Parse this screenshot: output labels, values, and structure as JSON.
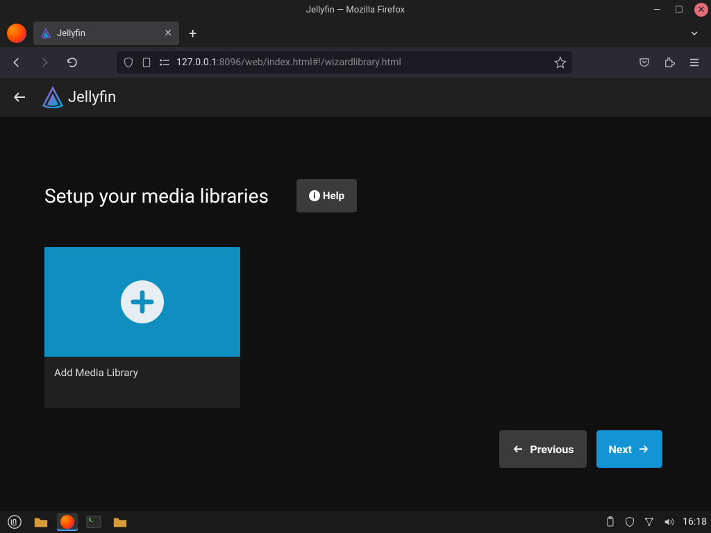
{
  "window": {
    "title": "Jellyfin — Mozilla Firefox"
  },
  "tab": {
    "title": "Jellyfin"
  },
  "url": {
    "host": "127.0.0.1",
    "port_path": ":8096/web/index.html#!/wizardlibrary.html"
  },
  "app": {
    "brand": "Jellyfin"
  },
  "page": {
    "heading": "Setup your media libraries",
    "help_label": "Help",
    "card_label": "Add Media Library",
    "previous_label": "Previous",
    "next_label": "Next"
  },
  "system": {
    "clock": "16:18"
  }
}
